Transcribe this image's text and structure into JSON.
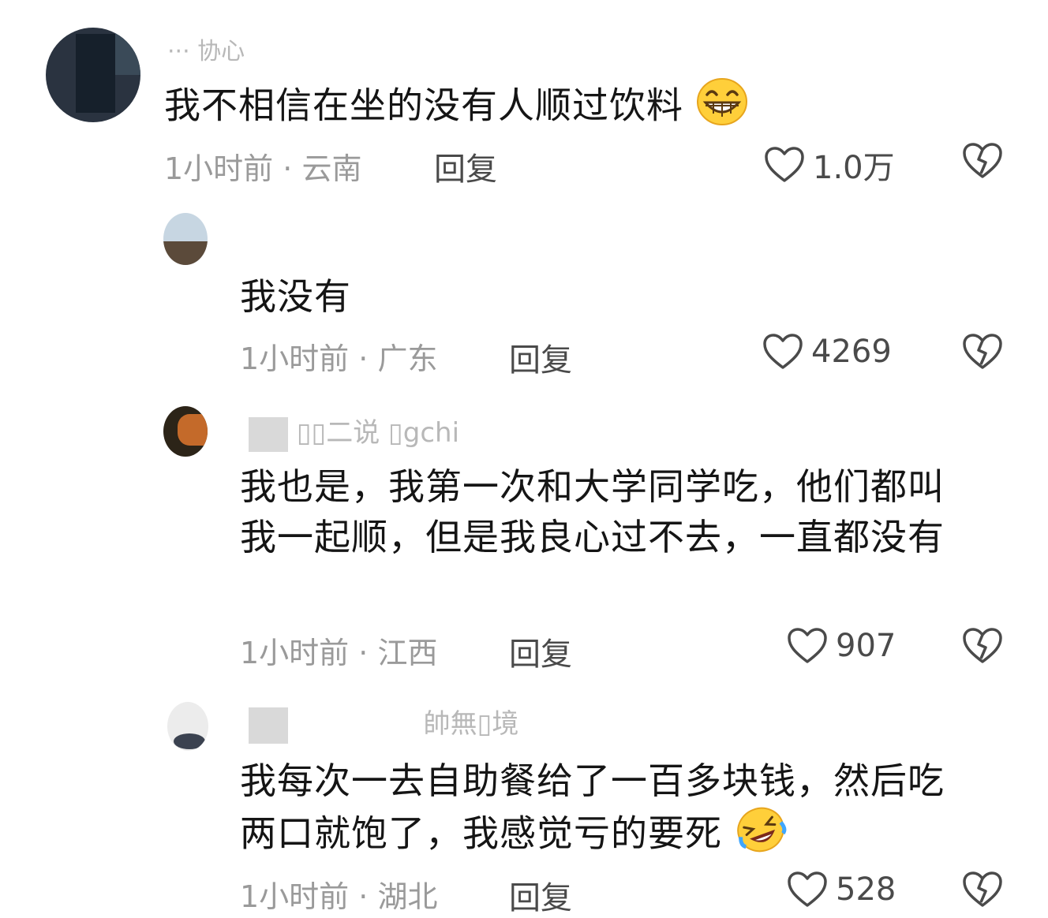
{
  "comments": [
    {
      "username": "··· 协心",
      "text": "我不相信在坐的没有人顺过饮料",
      "emoji": "grinning-face-emoji",
      "time": "1小时前",
      "location": "云南",
      "reply_label": "回复",
      "likes": "1.0万"
    },
    {
      "username": "",
      "text": "我没有",
      "time": "1小时前",
      "location": "广东",
      "reply_label": "回复",
      "likes": "4269"
    },
    {
      "username": "▯▯二说  ▯gchi",
      "text": "我也是，我第一次和大学同学吃，他们都叫我一起顺，但是我良心过不去，一直都没有",
      "time": "1小时前",
      "location": "江西",
      "reply_label": "回复",
      "likes": "907"
    },
    {
      "username": "帥無▯境",
      "text": "我每次一去自助餐给了一百多块钱，然后吃两口就饱了，我感觉亏的要死",
      "emoji": "rolling-on-floor-laughing-emoji",
      "time": "1小时前",
      "location": "湖北",
      "reply_label": "回复",
      "likes": "528"
    }
  ],
  "separator": "·"
}
